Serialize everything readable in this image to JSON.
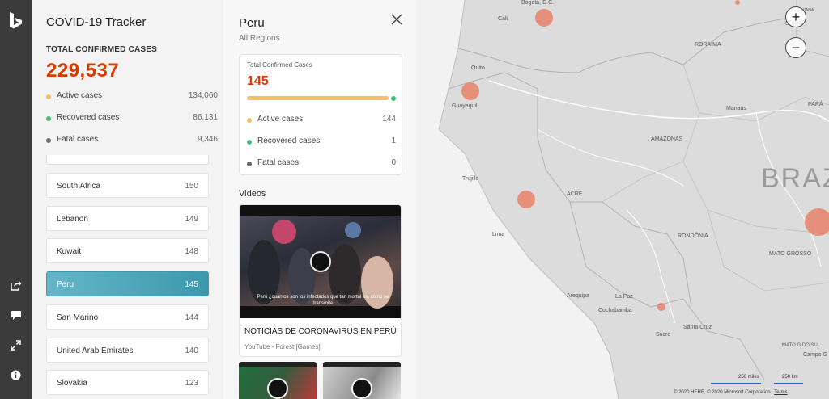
{
  "app": {
    "title": "COVID-19 Tracker",
    "total_label": "TOTAL CONFIRMED CASES",
    "total_value": "229,537",
    "stats": [
      {
        "label": "Active cases",
        "value": "134,060",
        "color": "#f2c162"
      },
      {
        "label": "Recovered cases",
        "value": "86,131",
        "color": "#4cbb7a"
      },
      {
        "label": "Fatal cases",
        "value": "9,346",
        "color": "#6b6b6b"
      }
    ],
    "countries": [
      {
        "name": "South Africa",
        "value": "150"
      },
      {
        "name": "Lebanon",
        "value": "149"
      },
      {
        "name": "Kuwait",
        "value": "148"
      },
      {
        "name": "Peru",
        "value": "145",
        "active": true
      },
      {
        "name": "San Marino",
        "value": "144"
      },
      {
        "name": "United Arab Emirates",
        "value": "140"
      },
      {
        "name": "Slovakia",
        "value": "123"
      }
    ]
  },
  "detail": {
    "title": "Peru",
    "subtitle": "All Regions",
    "card": {
      "label": "Total Confirmed Cases",
      "value": "145",
      "progress_active_fraction": 0.993,
      "stats": [
        {
          "label": "Active cases",
          "value": "144",
          "color": "#f2c162"
        },
        {
          "label": "Recovered cases",
          "value": "1",
          "color": "#4cbb7a"
        },
        {
          "label": "Fatal cases",
          "value": "0",
          "color": "#6b6b6b"
        }
      ]
    },
    "videos_label": "Videos",
    "video": {
      "title": "NOTICIAS DE CORONAVIRUS EN PERÚ",
      "source": "YouTube - Forest [Games]",
      "caption": "Perú ¿cuántos son los infectados que tan mortal es, cómo se transmite"
    }
  },
  "map": {
    "labels": {
      "bogota": "Bogotá, D.C.",
      "cali": "Cali",
      "quito": "Quito",
      "guayaquil": "Guayaquil",
      "trujillo": "Trujillo",
      "lima": "Lima",
      "arequipa": "Arequipa",
      "la_paz": "La Paz",
      "cochabamba": "Cochabamba",
      "sucre": "Sucre",
      "santa_cruz": "Santa Cruz",
      "manaus": "Manaus",
      "roraima": "RORAIMA",
      "amazonas": "AMAZONAS",
      "acre": "ACRE",
      "rondonia": "RONDÔNIA",
      "mato_grosso": "MATO GROSSO",
      "para": "PARÁ",
      "surin": "SURIN",
      "guian": "GUIANA",
      "campo": "Campo G",
      "mato_do_sul": "MATO G DO SUL",
      "brazil": "BRAZ"
    },
    "zoom_in": "+",
    "zoom_out": "−",
    "scale_miles": "250 miles",
    "scale_km": "250 km",
    "copyright": "© 2020 HERE, © 2020 Microsoft Corporation",
    "terms": "Terms",
    "bubble_color": "#e8826a"
  }
}
